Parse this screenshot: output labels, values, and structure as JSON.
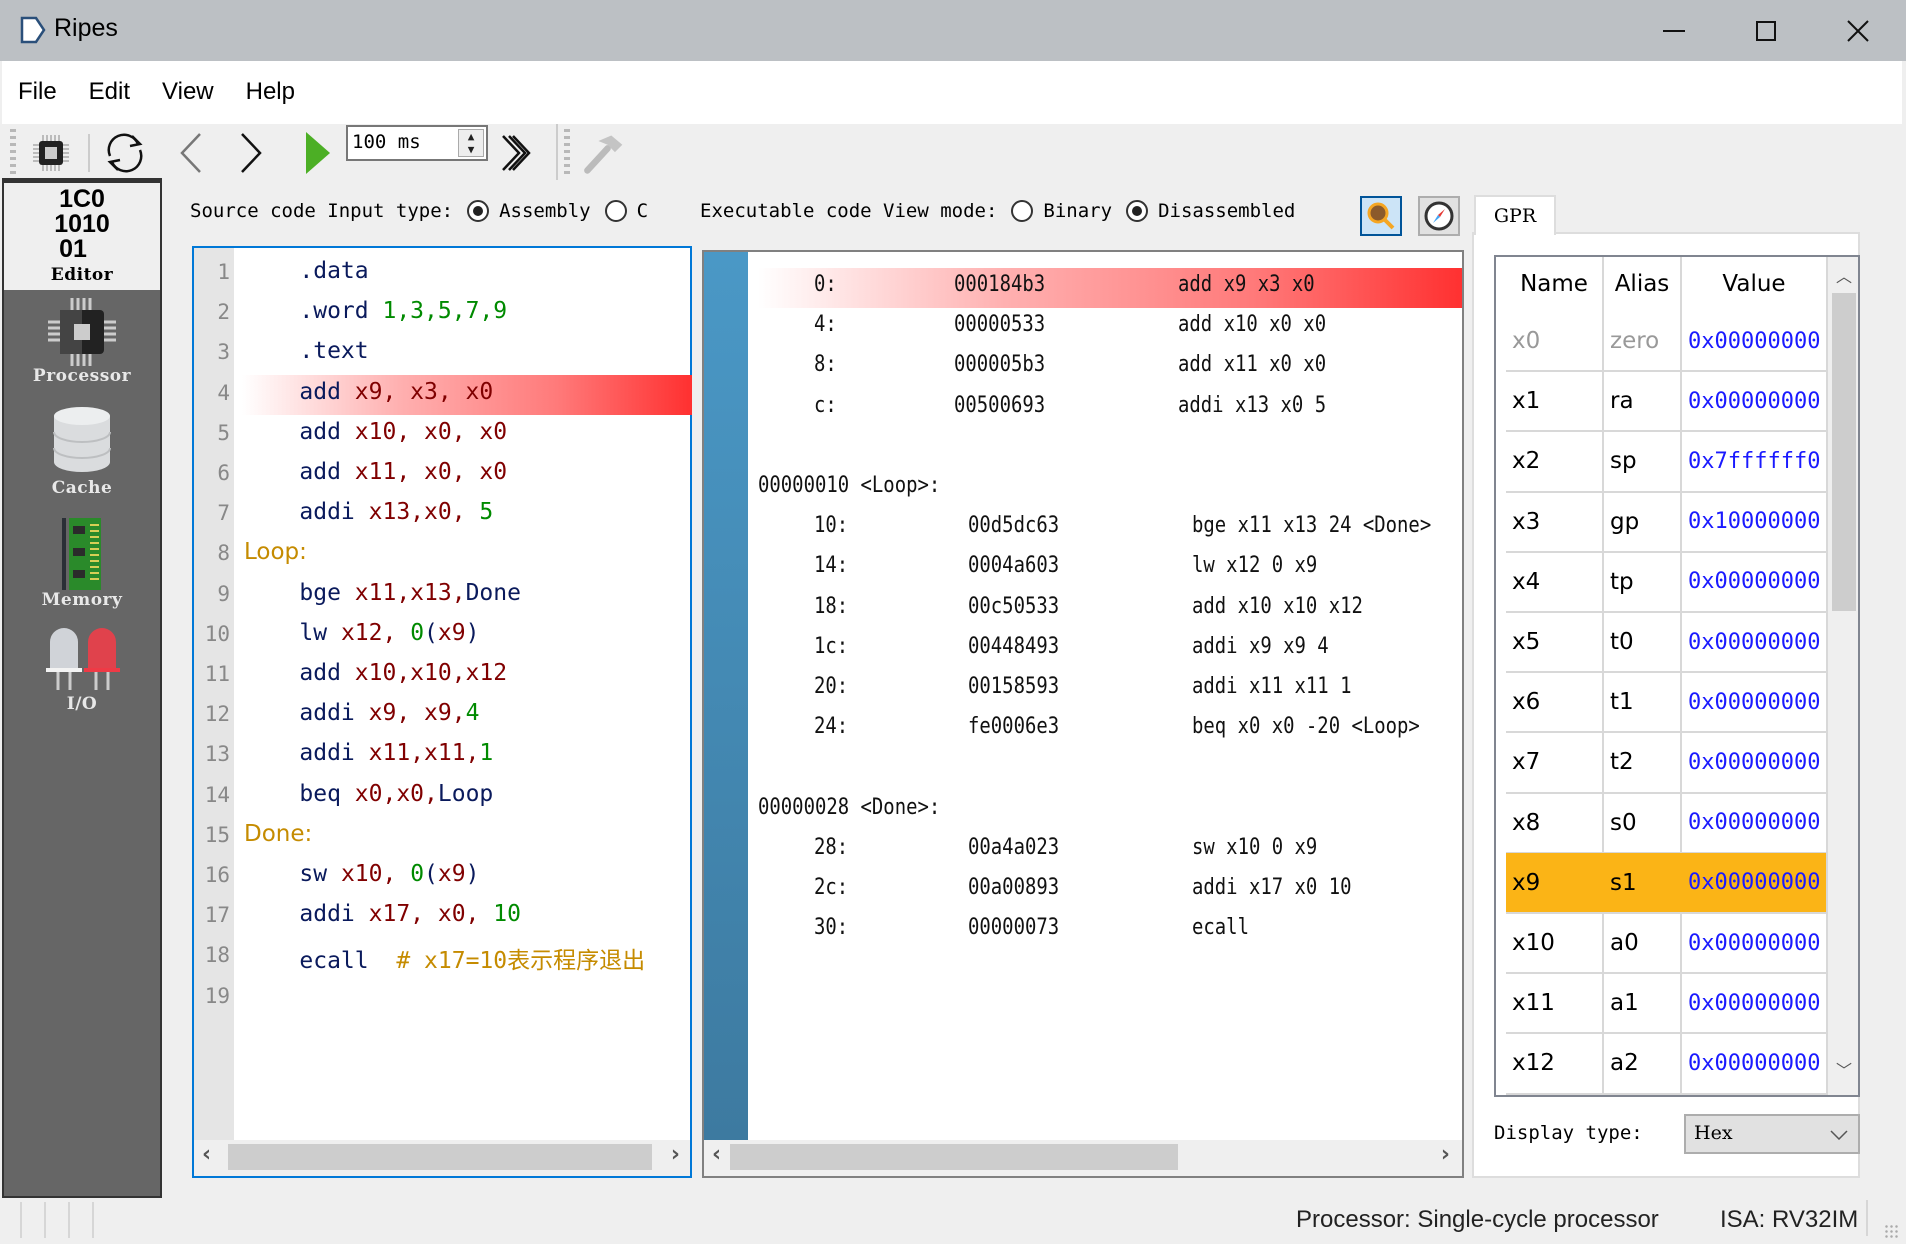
{
  "window": {
    "title": "Ripes",
    "minimize": "–",
    "maximize": "☐",
    "close": "✕"
  },
  "menu": [
    "File",
    "Edit",
    "View",
    "Help"
  ],
  "toolbar": {
    "speed_value": "100 ms"
  },
  "sidebar": {
    "editor_icon_text": [
      "1C0",
      "1010",
      "01"
    ],
    "items": [
      {
        "label": "Editor",
        "icon": "binary-icon",
        "selected": true
      },
      {
        "label": "Processor",
        "icon": "chip-icon"
      },
      {
        "label": "Cache",
        "icon": "database-icon"
      },
      {
        "label": "Memory",
        "icon": "ram-icon"
      },
      {
        "label": "I/O",
        "icon": "led-icon"
      }
    ]
  },
  "source_header": {
    "label": "Source code Input type:",
    "options": [
      {
        "label": "Assembly",
        "checked": true
      },
      {
        "label": "C",
        "checked": false
      }
    ]
  },
  "exec_header": {
    "label": "Executable code View mode:",
    "options": [
      {
        "label": "Binary",
        "checked": false
      },
      {
        "label": "Disassembled",
        "checked": true
      }
    ]
  },
  "editor": {
    "highlighted_line": 4,
    "lines": [
      {
        "n": "1",
        "tokens": [
          [
            "dir",
            "    .data"
          ]
        ]
      },
      {
        "n": "2",
        "tokens": [
          [
            "dir",
            "    .word "
          ],
          [
            "num",
            "1,3,5,7,9"
          ]
        ]
      },
      {
        "n": "3",
        "tokens": [
          [
            "dir",
            "    .text"
          ]
        ]
      },
      {
        "n": "4",
        "tokens": [
          [
            "dir",
            "    add "
          ],
          [
            "reg",
            "x9, x3, x0"
          ]
        ]
      },
      {
        "n": "5",
        "tokens": [
          [
            "dir",
            "    add "
          ],
          [
            "reg",
            "x10, x0, x0"
          ]
        ]
      },
      {
        "n": "6",
        "tokens": [
          [
            "dir",
            "    add "
          ],
          [
            "reg",
            "x11, x0, x0"
          ]
        ]
      },
      {
        "n": "7",
        "tokens": [
          [
            "dir",
            "    addi "
          ],
          [
            "reg",
            "x13,x0, "
          ],
          [
            "num",
            "5"
          ]
        ]
      },
      {
        "n": "8",
        "tokens": [
          [
            "lbl",
            "Loop:"
          ]
        ]
      },
      {
        "n": "9",
        "tokens": [
          [
            "dir",
            "    bge "
          ],
          [
            "reg",
            "x11,x13,"
          ],
          [
            "dir",
            "Done"
          ]
        ]
      },
      {
        "n": "10",
        "tokens": [
          [
            "dir",
            "    lw "
          ],
          [
            "reg",
            "x12, "
          ],
          [
            "num",
            "0"
          ],
          [
            "dir",
            "("
          ],
          [
            "reg",
            "x9"
          ],
          [
            "dir",
            ")"
          ]
        ]
      },
      {
        "n": "11",
        "tokens": [
          [
            "dir",
            "    add "
          ],
          [
            "reg",
            "x10,x10,x12"
          ]
        ]
      },
      {
        "n": "12",
        "tokens": [
          [
            "dir",
            "    addi "
          ],
          [
            "reg",
            "x9, x9,"
          ],
          [
            "num",
            "4"
          ]
        ]
      },
      {
        "n": "13",
        "tokens": [
          [
            "dir",
            "    addi "
          ],
          [
            "reg",
            "x11,x11,"
          ],
          [
            "num",
            "1"
          ]
        ]
      },
      {
        "n": "14",
        "tokens": [
          [
            "dir",
            "    beq "
          ],
          [
            "reg",
            "x0,x0,"
          ],
          [
            "dir",
            "Loop"
          ]
        ]
      },
      {
        "n": "15",
        "tokens": [
          [
            "lbl",
            "Done:"
          ]
        ]
      },
      {
        "n": "16",
        "tokens": [
          [
            "dir",
            "    sw "
          ],
          [
            "reg",
            "x10, "
          ],
          [
            "num",
            "0"
          ],
          [
            "dir",
            "("
          ],
          [
            "reg",
            "x9"
          ],
          [
            "dir",
            ")"
          ]
        ]
      },
      {
        "n": "17",
        "tokens": [
          [
            "dir",
            "    addi "
          ],
          [
            "reg",
            "x17, x0, "
          ],
          [
            "num",
            "10"
          ]
        ]
      },
      {
        "n": "18",
        "tokens": [
          [
            "dir",
            "    ecall  "
          ],
          [
            "cmt",
            "# x17=10表示程序退出"
          ]
        ]
      },
      {
        "n": "19",
        "tokens": []
      }
    ]
  },
  "disassembly": {
    "highlighted_index": 0,
    "lines": [
      {
        "type": "instr",
        "addr": "0:",
        "code": "000184b3",
        "asm": "add x9 x3 x0",
        "indent": 0
      },
      {
        "type": "instr",
        "addr": "4:",
        "code": "00000533",
        "asm": "add x10 x0 x0",
        "indent": 0
      },
      {
        "type": "instr",
        "addr": "8:",
        "code": "000005b3",
        "asm": "add x11 x0 x0",
        "indent": 0
      },
      {
        "type": "instr",
        "addr": "c:",
        "code": "00500693",
        "asm": "addi x13 x0 5",
        "indent": 0
      },
      {
        "type": "blank"
      },
      {
        "type": "label",
        "text": "00000010 <Loop>:"
      },
      {
        "type": "instr",
        "addr": "10:",
        "code": "00d5dc63",
        "asm": "bge x11 x13 24 <Done>",
        "indent": 1
      },
      {
        "type": "instr",
        "addr": "14:",
        "code": "0004a603",
        "asm": "lw x12 0 x9",
        "indent": 1
      },
      {
        "type": "instr",
        "addr": "18:",
        "code": "00c50533",
        "asm": "add x10 x10 x12",
        "indent": 1
      },
      {
        "type": "instr",
        "addr": "1c:",
        "code": "00448493",
        "asm": "addi x9 x9 4",
        "indent": 1
      },
      {
        "type": "instr",
        "addr": "20:",
        "code": "00158593",
        "asm": "addi x11 x11 1",
        "indent": 1
      },
      {
        "type": "instr",
        "addr": "24:",
        "code": "fe0006e3",
        "asm": "beq x0 x0 -20 <Loop>",
        "indent": 1
      },
      {
        "type": "blank"
      },
      {
        "type": "label",
        "text": "00000028 <Done>:"
      },
      {
        "type": "instr",
        "addr": "28:",
        "code": "00a4a023",
        "asm": "sw x10 0 x9",
        "indent": 1
      },
      {
        "type": "instr",
        "addr": "2c:",
        "code": "00a00893",
        "asm": "addi x17 x0 10",
        "indent": 1
      },
      {
        "type": "instr",
        "addr": "30:",
        "code": "00000073",
        "asm": "ecall",
        "indent": 1
      }
    ]
  },
  "registers": {
    "tab": "GPR",
    "columns": [
      "Name",
      "Alias",
      "Value"
    ],
    "highlighted": "x9",
    "highlight_color": "#fbb416",
    "rows": [
      {
        "name": "x0",
        "alias": "zero",
        "value": "0x00000000",
        "dim": true
      },
      {
        "name": "x1",
        "alias": "ra",
        "value": "0x00000000"
      },
      {
        "name": "x2",
        "alias": "sp",
        "value": "0x7ffffff0"
      },
      {
        "name": "x3",
        "alias": "gp",
        "value": "0x10000000"
      },
      {
        "name": "x4",
        "alias": "tp",
        "value": "0x00000000"
      },
      {
        "name": "x5",
        "alias": "t0",
        "value": "0x00000000"
      },
      {
        "name": "x6",
        "alias": "t1",
        "value": "0x00000000"
      },
      {
        "name": "x7",
        "alias": "t2",
        "value": "0x00000000"
      },
      {
        "name": "x8",
        "alias": "s0",
        "value": "0x00000000"
      },
      {
        "name": "x9",
        "alias": "s1",
        "value": "0x00000000"
      },
      {
        "name": "x10",
        "alias": "a0",
        "value": "0x00000000"
      },
      {
        "name": "x11",
        "alias": "a1",
        "value": "0x00000000"
      },
      {
        "name": "x12",
        "alias": "a2",
        "value": "0x00000000"
      }
    ],
    "display_type_label": "Display type:",
    "display_type_value": "Hex"
  },
  "status": {
    "processor": "Processor: Single-cycle processor",
    "isa": "ISA: RV32IM"
  }
}
